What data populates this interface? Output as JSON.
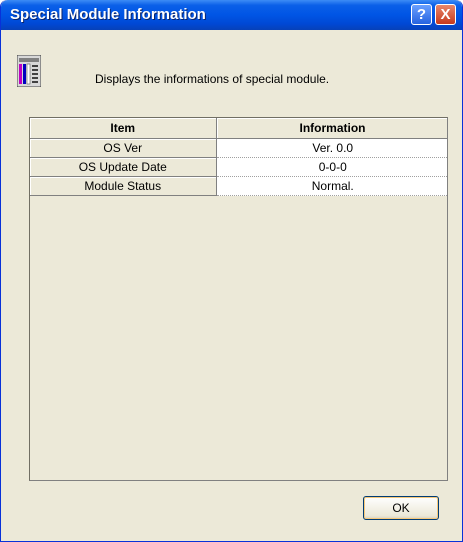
{
  "window": {
    "title": "Special Module Information",
    "help_glyph": "?",
    "close_glyph": "X"
  },
  "header": {
    "icon": "module-icon",
    "description": "Displays the informations of special module."
  },
  "table": {
    "columns": [
      "Item",
      "Information"
    ],
    "rows": [
      {
        "item": "OS Ver",
        "info": "Ver.  0.0"
      },
      {
        "item": "OS Update Date",
        "info": "0-0-0"
      },
      {
        "item": "Module Status",
        "info": "Normal."
      }
    ]
  },
  "buttons": {
    "ok": "OK"
  },
  "colors": {
    "titlebar": "#0055e5",
    "dialog_bg": "#ece9d8",
    "close_button": "#c6391d"
  }
}
